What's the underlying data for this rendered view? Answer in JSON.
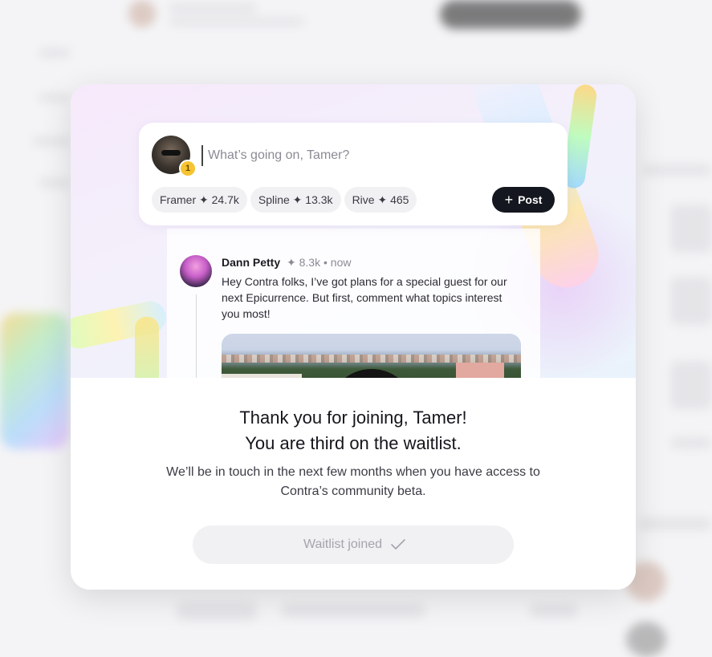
{
  "composer": {
    "placeholder": "What’s going on, Tamer?",
    "avatar_badge": "1",
    "chips": [
      {
        "label": "Framer ✦ 24.7k"
      },
      {
        "label": "Spline ✦ 13.3k"
      },
      {
        "label": "Rive ✦ 465"
      }
    ],
    "post_label": "Post"
  },
  "post": {
    "author": "Dann Petty",
    "meta": "✦ 8.3k • now",
    "body": "Hey Contra folks, I’ve got plans for a special guest for our next Epicurrence. But first, comment what topics interest you most!"
  },
  "modal": {
    "title_line1": "Thank you for joining, Tamer!",
    "title_line2": "You are third on the waitlist.",
    "subtitle": "We’ll be in touch in the next few months when you have access to Contra’s community beta.",
    "button_label": "Waitlist joined"
  },
  "icons": {
    "plus": "plus-icon",
    "check": "checkmark-icon"
  }
}
